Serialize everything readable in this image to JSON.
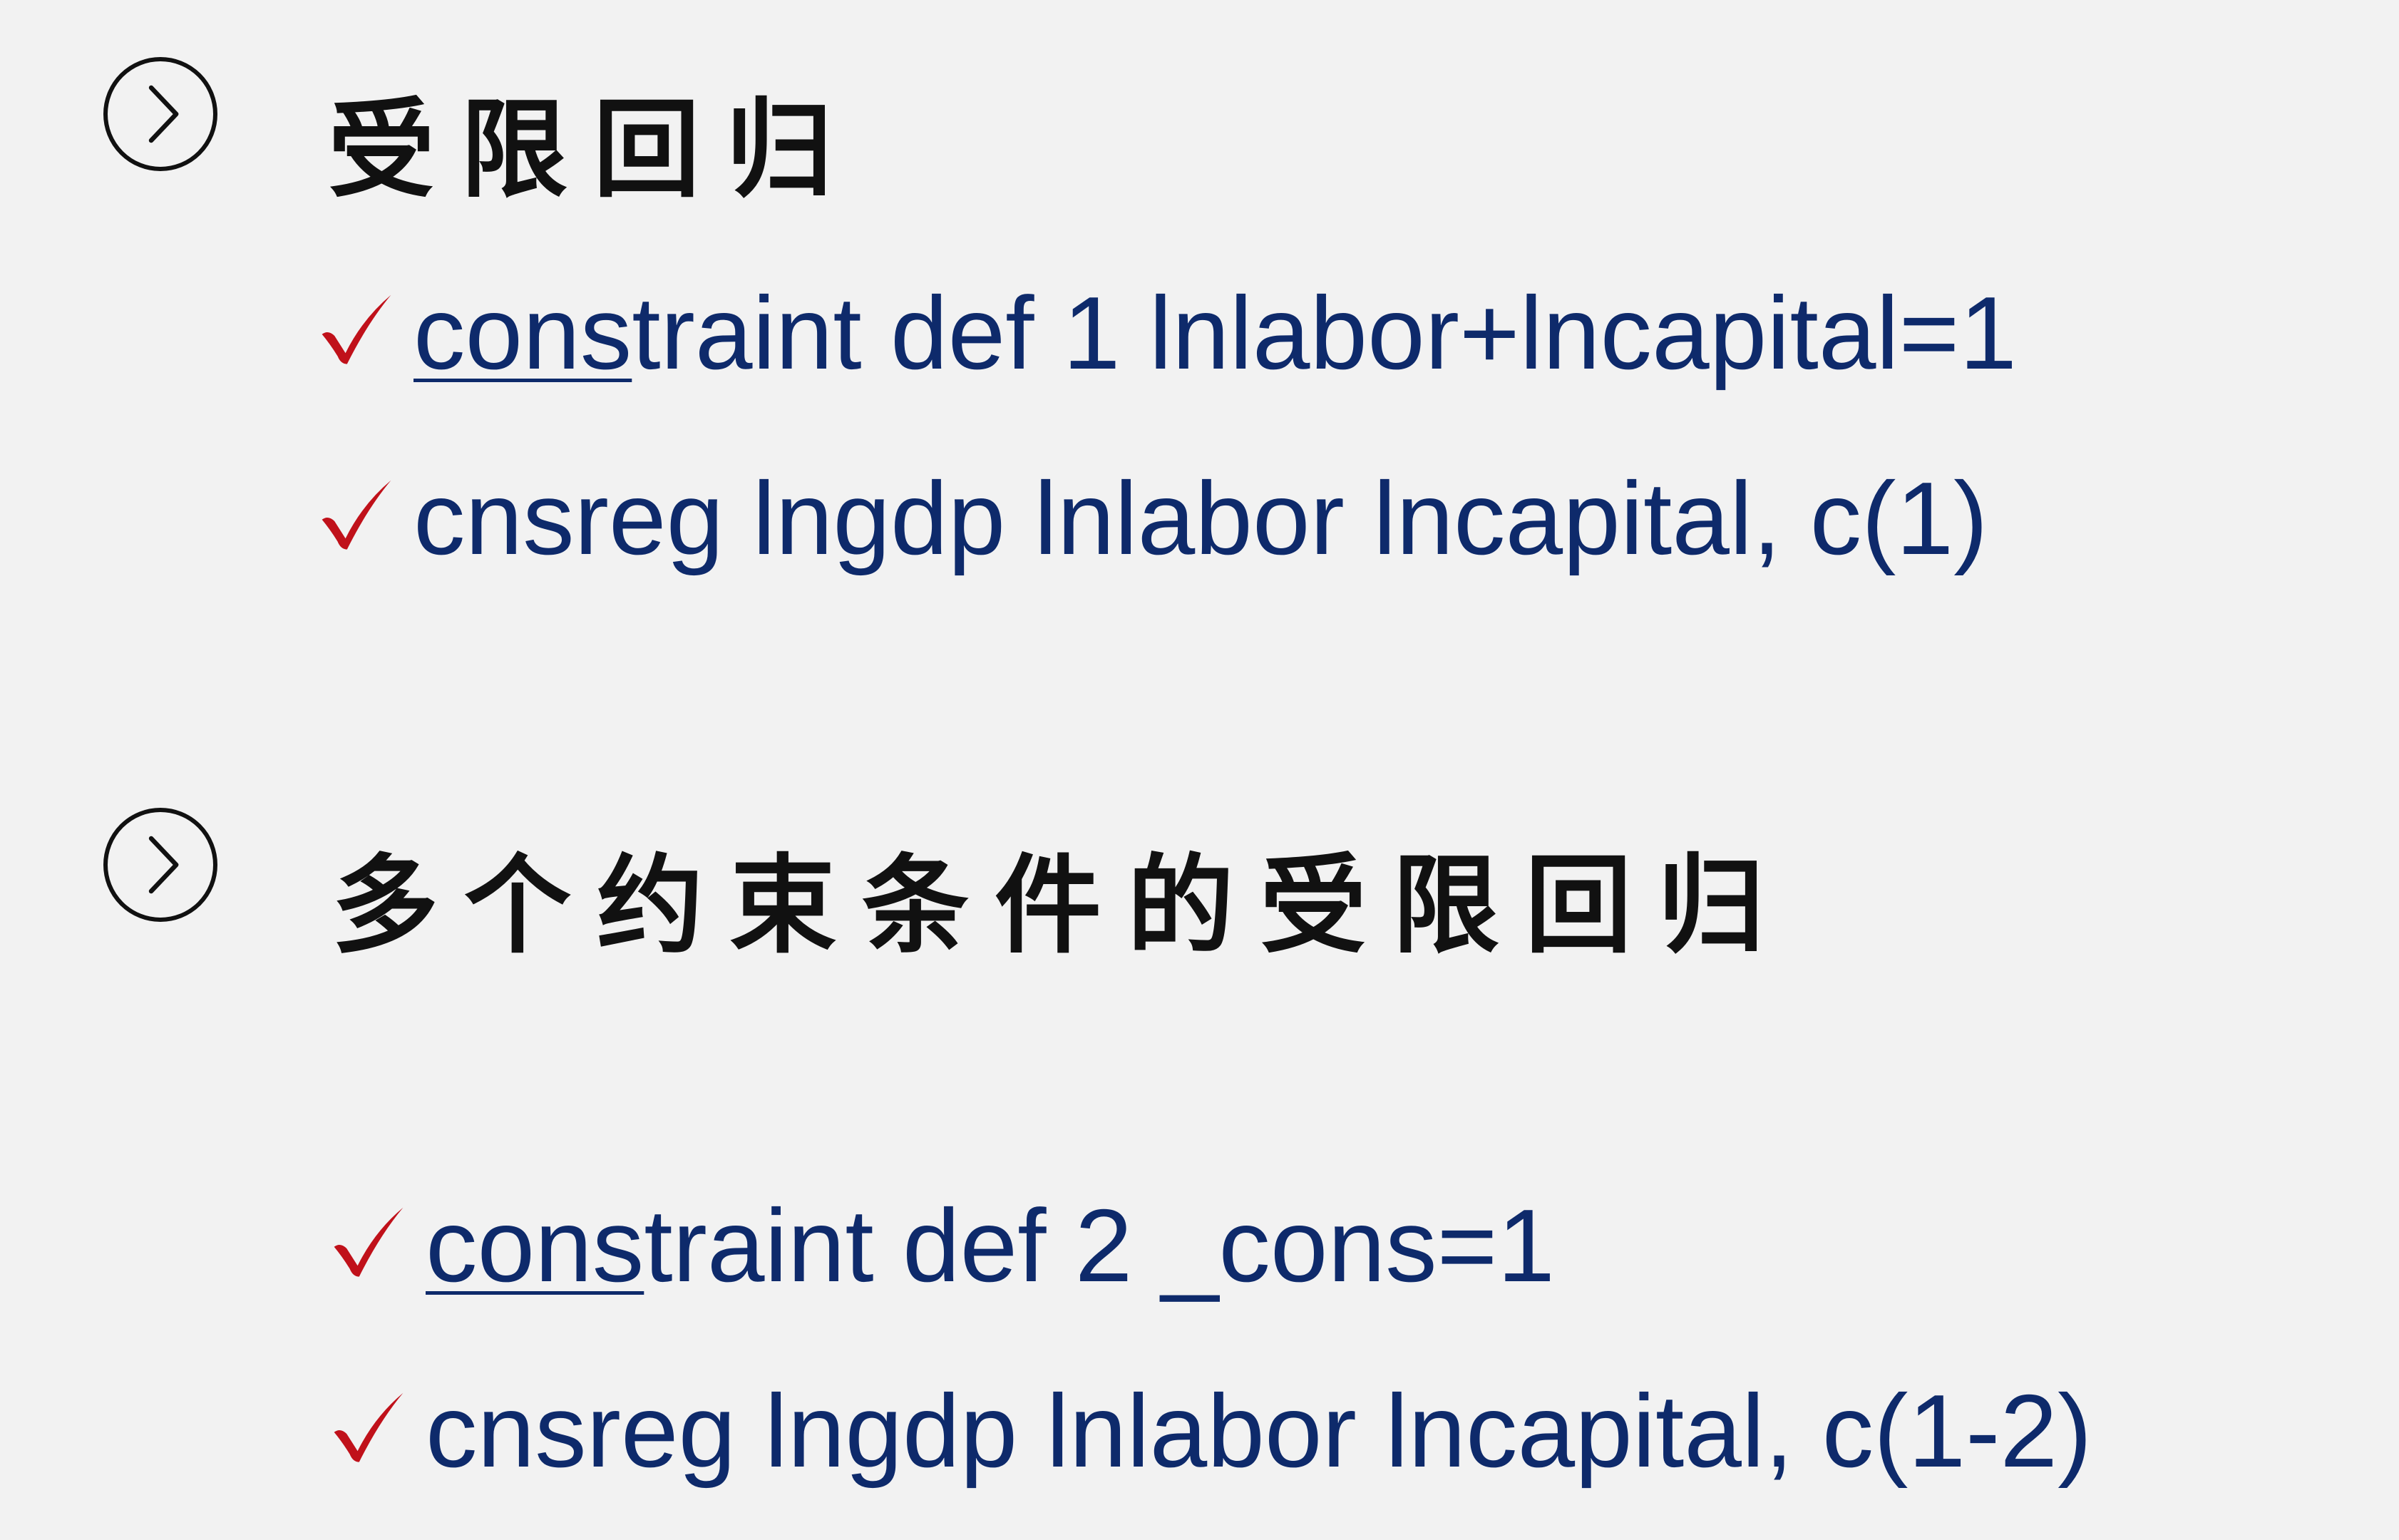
{
  "sections": [
    {
      "heading": "受限回归",
      "items": [
        {
          "underlined": "cons",
          "rest": "traint def 1 lnlabor+lncapital=1"
        },
        {
          "underlined": "",
          "rest": "cnsreg lngdp lnlabor lncapital, c(1)"
        }
      ]
    },
    {
      "heading": "多个约束条件的受限回归",
      "items": [
        {
          "underlined": "cons",
          "rest": "traint def 2 _cons=1"
        },
        {
          "underlined": "",
          "rest": "cnsreg lngdp lnlabor lncapital, c(1-2)"
        }
      ]
    }
  ],
  "colors": {
    "background": "#f2f2f2",
    "command_text": "#0e2a6b",
    "check_mark": "#c0111a",
    "heading_text": "#111111"
  },
  "icons": {
    "section_marker": "chevron-right-circle-icon",
    "item_marker": "check-icon"
  }
}
